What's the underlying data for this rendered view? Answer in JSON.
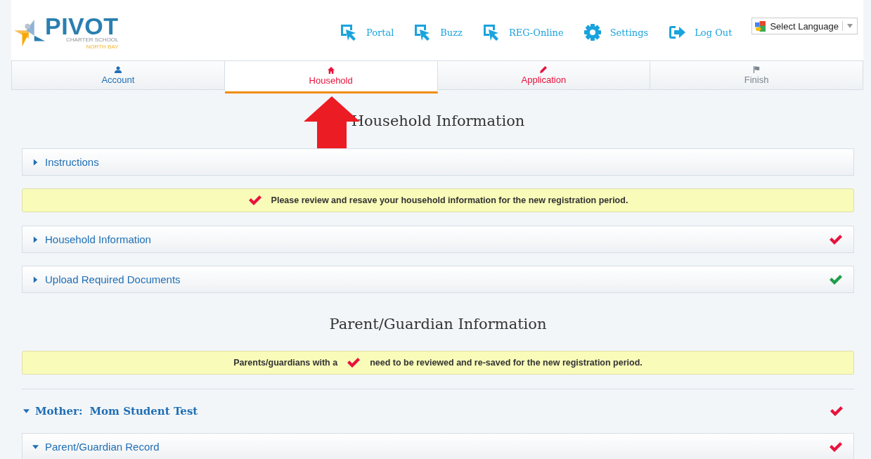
{
  "header": {
    "logo": {
      "name": "PIVOT",
      "line1": "CHARTER SCHOOL",
      "line2": "NORTH BAY"
    },
    "nav_links": [
      {
        "label": "Portal",
        "kind": "cursor"
      },
      {
        "label": "Buzz",
        "kind": "cursor"
      },
      {
        "label": "REG-Online",
        "kind": "cursor"
      },
      {
        "label": "Settings",
        "kind": "gear"
      },
      {
        "label": "Log Out",
        "kind": "logout"
      }
    ],
    "language_select": {
      "value": "Select Language"
    }
  },
  "tabs": [
    {
      "label": "Account",
      "kind": "person",
      "selected": false,
      "color": "#1f6fb5"
    },
    {
      "label": "Household",
      "kind": "home",
      "selected": true,
      "color": "#e8123c"
    },
    {
      "label": "Application",
      "kind": "pencil",
      "selected": false,
      "color": "#e8123c"
    },
    {
      "label": "Finish",
      "kind": "flag",
      "selected": false,
      "color": "#7b858f"
    }
  ],
  "content": [
    {
      "kind": "heading",
      "text": "Household Information"
    },
    {
      "kind": "panel",
      "label": "Instructions",
      "expanded": false
    },
    {
      "kind": "notice",
      "text_after": "Please review and resave your household information for the new registration period."
    },
    {
      "kind": "panel",
      "label": "Household Information",
      "expanded": false,
      "reviewed": false
    },
    {
      "kind": "panel",
      "label": "Upload Required Documents",
      "expanded": false,
      "reviewed": true
    },
    {
      "kind": "heading",
      "text": "Parent/Guardian Information"
    },
    {
      "kind": "notice",
      "text_before": "Parents/guardians with a",
      "text_after": "need to be reviewed and re-saved for the new registration period."
    },
    {
      "kind": "divider"
    },
    {
      "kind": "person",
      "role": "Mother:",
      "name": "Mom Student Test",
      "expanded": true,
      "reviewed": false
    },
    {
      "kind": "panel",
      "label": "Parent/Guardian Record",
      "expanded": true,
      "reviewed": false
    }
  ]
}
